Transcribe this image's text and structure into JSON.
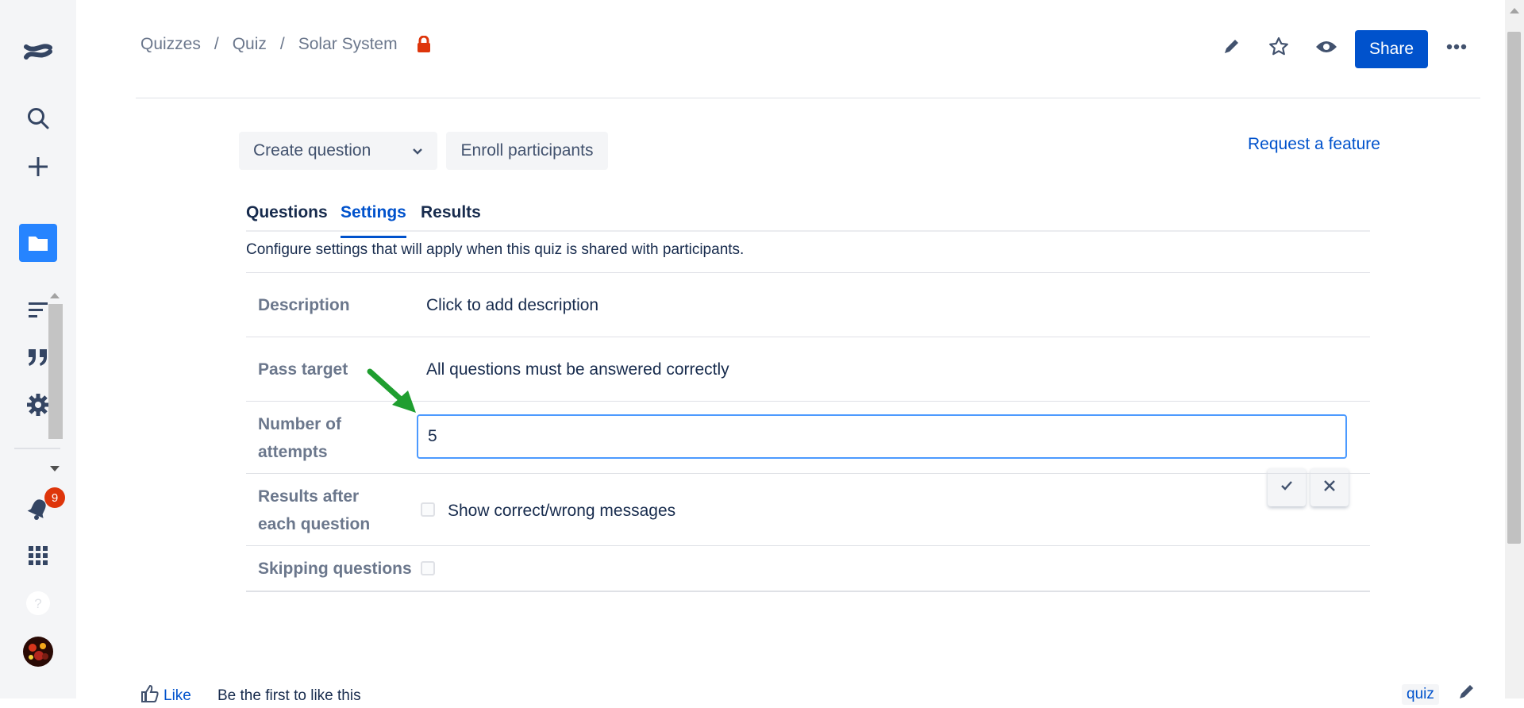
{
  "breadcrumb": {
    "items": [
      "Quizzes",
      "Quiz",
      "Solar System"
    ],
    "separator": "/"
  },
  "header": {
    "share_label": "Share"
  },
  "toolbar": {
    "create_label": "Create question",
    "enroll_label": "Enroll participants",
    "request_label": "Request a feature"
  },
  "tabs": [
    {
      "label": "Questions",
      "active": false
    },
    {
      "label": "Settings",
      "active": true
    },
    {
      "label": "Results",
      "active": false
    }
  ],
  "settings": {
    "helper": "Configure settings that will apply when this quiz is shared with participants.",
    "description": {
      "label": "Description",
      "value": "Click to add description"
    },
    "pass_target": {
      "label": "Pass target",
      "value": "All questions must be answered correctly"
    },
    "attempts": {
      "label": "Number of attempts",
      "value": "5"
    },
    "results": {
      "label": "Results after each question",
      "option": "Show correct/wrong messages",
      "checked": false
    },
    "skipping": {
      "label": "Skipping questions",
      "checked": false
    }
  },
  "notifications": {
    "count": "9"
  },
  "footer": {
    "like_label": "Like",
    "like_text": "Be the first to like this",
    "tag": "quiz"
  },
  "colors": {
    "accent": "#0052cc",
    "focus": "#4c9aff",
    "annotation_arrow": "#1f9e2f",
    "badge": "#de350b"
  },
  "icons": [
    "confluence-logo-icon",
    "search-icon",
    "plus-icon",
    "folder-icon",
    "list-icon",
    "quote-icon",
    "gear-icon",
    "bell-icon",
    "apps-grid-icon",
    "help-icon",
    "avatar",
    "lock-icon",
    "pencil-icon",
    "star-icon",
    "eye-icon",
    "more-icon",
    "chevron-down-icon",
    "check-icon",
    "close-icon",
    "thumbs-up-icon"
  ]
}
